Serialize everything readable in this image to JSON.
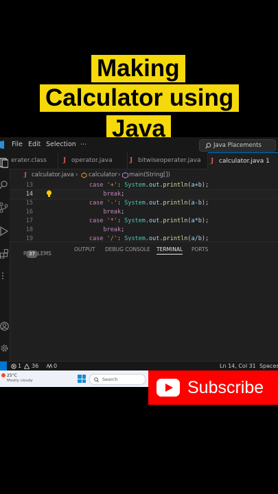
{
  "overlay": {
    "title_lines": [
      "Making",
      "Calculator using",
      "Java"
    ]
  },
  "menubar": {
    "items": [
      "File",
      "Edit",
      "Selection",
      "⋯"
    ],
    "search_text": "Java Placements"
  },
  "tabs": [
    {
      "label": "erater.class",
      "active": false,
      "icon": ""
    },
    {
      "label": "operator.java",
      "active": false,
      "icon": "J"
    },
    {
      "label": "bitwiseoperater.java",
      "active": false,
      "icon": "J"
    },
    {
      "label": "calculator.java 1",
      "active": true,
      "icon": "J"
    }
  ],
  "breadcrumb": {
    "file": "calculator.java",
    "class": "calculator",
    "method": "main(String[])"
  },
  "editor": {
    "lines": [
      {
        "num": "13",
        "indent": "",
        "tokens": [
          [
            "kw",
            "case "
          ],
          [
            "str",
            "'+'"
          ],
          [
            "plain",
            ": "
          ],
          [
            "cls",
            "System"
          ],
          [
            "plain",
            "."
          ],
          [
            "var",
            "out"
          ],
          [
            "plain",
            "."
          ],
          [
            "fn",
            "println"
          ],
          [
            "plain",
            "("
          ],
          [
            "var",
            "a"
          ],
          [
            "plain",
            "+"
          ],
          [
            "var",
            "b"
          ],
          [
            "plain",
            ");"
          ]
        ]
      },
      {
        "num": "14",
        "indent": "    ",
        "tokens": [
          [
            "kw",
            "break"
          ],
          [
            "plain",
            ";"
          ]
        ]
      },
      {
        "num": "15",
        "indent": "",
        "tokens": [
          [
            "kw",
            "case "
          ],
          [
            "str",
            "'-'"
          ],
          [
            "plain",
            ": "
          ],
          [
            "cls",
            "System"
          ],
          [
            "plain",
            "."
          ],
          [
            "var",
            "out"
          ],
          [
            "plain",
            "."
          ],
          [
            "fn",
            "println"
          ],
          [
            "plain",
            "("
          ],
          [
            "var",
            "a"
          ],
          [
            "plain",
            "-"
          ],
          [
            "var",
            "b"
          ],
          [
            "plain",
            ");"
          ]
        ]
      },
      {
        "num": "16",
        "indent": "    ",
        "tokens": [
          [
            "kw",
            "break"
          ],
          [
            "plain",
            ";"
          ]
        ]
      },
      {
        "num": "17",
        "indent": "",
        "tokens": [
          [
            "kw",
            "case "
          ],
          [
            "str",
            "'*'"
          ],
          [
            "plain",
            ": "
          ],
          [
            "cls",
            "System"
          ],
          [
            "plain",
            "."
          ],
          [
            "var",
            "out"
          ],
          [
            "plain",
            "."
          ],
          [
            "fn",
            "println"
          ],
          [
            "plain",
            "("
          ],
          [
            "var",
            "a"
          ],
          [
            "plain",
            "*"
          ],
          [
            "var",
            "b"
          ],
          [
            "plain",
            ");"
          ]
        ]
      },
      {
        "num": "18",
        "indent": "    ",
        "tokens": [
          [
            "kw",
            "break"
          ],
          [
            "plain",
            ";"
          ]
        ]
      },
      {
        "num": "19",
        "indent": "",
        "tokens": [
          [
            "kw",
            "case "
          ],
          [
            "str",
            "'/'"
          ],
          [
            "plain",
            ": "
          ],
          [
            "cls",
            "System"
          ],
          [
            "plain",
            "."
          ],
          [
            "var",
            "out"
          ],
          [
            "plain",
            "."
          ],
          [
            "fn",
            "println"
          ],
          [
            "plain",
            "("
          ],
          [
            "var",
            "a"
          ],
          [
            "plain",
            "/"
          ],
          [
            "var",
            "b"
          ],
          [
            "plain",
            ");"
          ]
        ]
      }
    ],
    "current_line": "14"
  },
  "panel": {
    "problems_label": "PROBLEMS",
    "problems_count": "37",
    "output_label": "OUTPUT",
    "debug_label": "DEBUG CONSOLE",
    "terminal_label": "TERMINAL",
    "ports_label": "PORTS"
  },
  "statusbar": {
    "errors": "1",
    "warnings": "36",
    "ports": "0",
    "position": "Ln 14, Col 31",
    "spaces": "Spaces:"
  },
  "taskbar": {
    "temperature": "25°C",
    "weather": "Mostly cloudy",
    "search_placeholder": "Search"
  },
  "subscribe": {
    "label": "Subscribe"
  },
  "colors": {
    "title_bg": "#f5d90a",
    "subscribe_bg": "#ff0000",
    "editor_bg": "#1f1f1f",
    "java_icon": "#e05a4e",
    "accent": "#0078d4"
  }
}
